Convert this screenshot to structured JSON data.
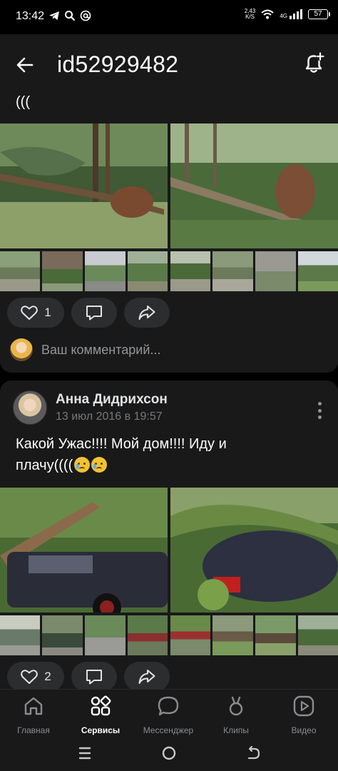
{
  "status_bar": {
    "time": "13:42",
    "speed_value": "2,43",
    "speed_unit": "K/S",
    "network": "4G",
    "battery": "57",
    "icons": [
      "telegram-icon",
      "search-icon",
      "at-icon",
      "wifi-icon",
      "signal-icon",
      "battery-icon"
    ]
  },
  "header": {
    "title": "id52929482",
    "back_icon": "arrow-left-icon",
    "bell_icon": "bell-plus-icon"
  },
  "post1": {
    "text": "(((",
    "likes": "1",
    "comment_placeholder": "Ваш комментарий..."
  },
  "post2": {
    "author": "Анна Дидрихсон",
    "date": "13 июл 2016 в 19:57",
    "text_line1": "Какой Ужас!!!! Мой дом!!!! Иду и",
    "text_line2": "плачу((((",
    "likes": "2"
  },
  "tabbar": {
    "items": [
      {
        "label": "Главная",
        "icon": "home-icon",
        "active": false
      },
      {
        "label": "Сервисы",
        "icon": "services-icon",
        "active": true
      },
      {
        "label": "Мессенджер",
        "icon": "chat-icon",
        "active": false
      },
      {
        "label": "Клипы",
        "icon": "clips-icon",
        "active": false
      },
      {
        "label": "Видео",
        "icon": "video-icon",
        "active": false
      }
    ]
  },
  "colors": {
    "background": "#000000",
    "surface": "#19191a",
    "pill": "#2c2d2e",
    "text_primary": "#e1e3e6",
    "text_secondary": "#76787a"
  }
}
